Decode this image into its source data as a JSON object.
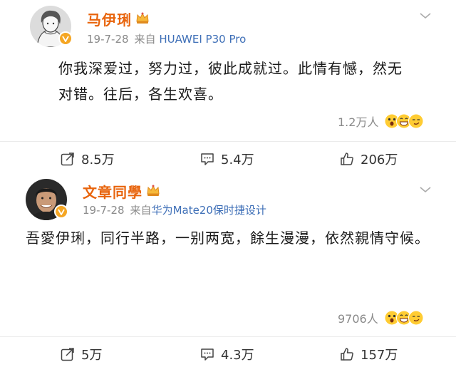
{
  "posts": [
    {
      "user_name": "马伊琍",
      "date": "19-7-28",
      "source_prefix": "来自",
      "source": "HUAWEI P30 Pro",
      "content": "你我深爱过，努力过，彼此成就过。此情有憾，然无对错。往后，各生欢喜。",
      "reactions_count": "1.2万人",
      "repost_count": "8.5万",
      "comment_count": "5.4万",
      "like_count": "206万"
    },
    {
      "user_name": "文章同學",
      "date": "19-7-28",
      "source_prefix": "来自",
      "source": "华为Mate20保时捷设计",
      "content": "吾愛伊琍，同行半路，一别两宽，餘生漫漫，依然親情守候。",
      "reactions_count": "9706人",
      "repost_count": "5万",
      "comment_count": "4.3万",
      "like_count": "157万"
    }
  ],
  "colors": {
    "username": "#e8640c",
    "source_link": "#3e6fb7",
    "meta_gray": "#8a8a8a",
    "verified_badge": "#f5a623"
  },
  "icons": [
    "verified-badge-icon",
    "crown-icon",
    "chevron-down-icon",
    "repost-icon",
    "comment-icon",
    "like-icon",
    "shocked-emoji-icon",
    "grin-emoji-icon",
    "smirk-emoji-icon"
  ]
}
